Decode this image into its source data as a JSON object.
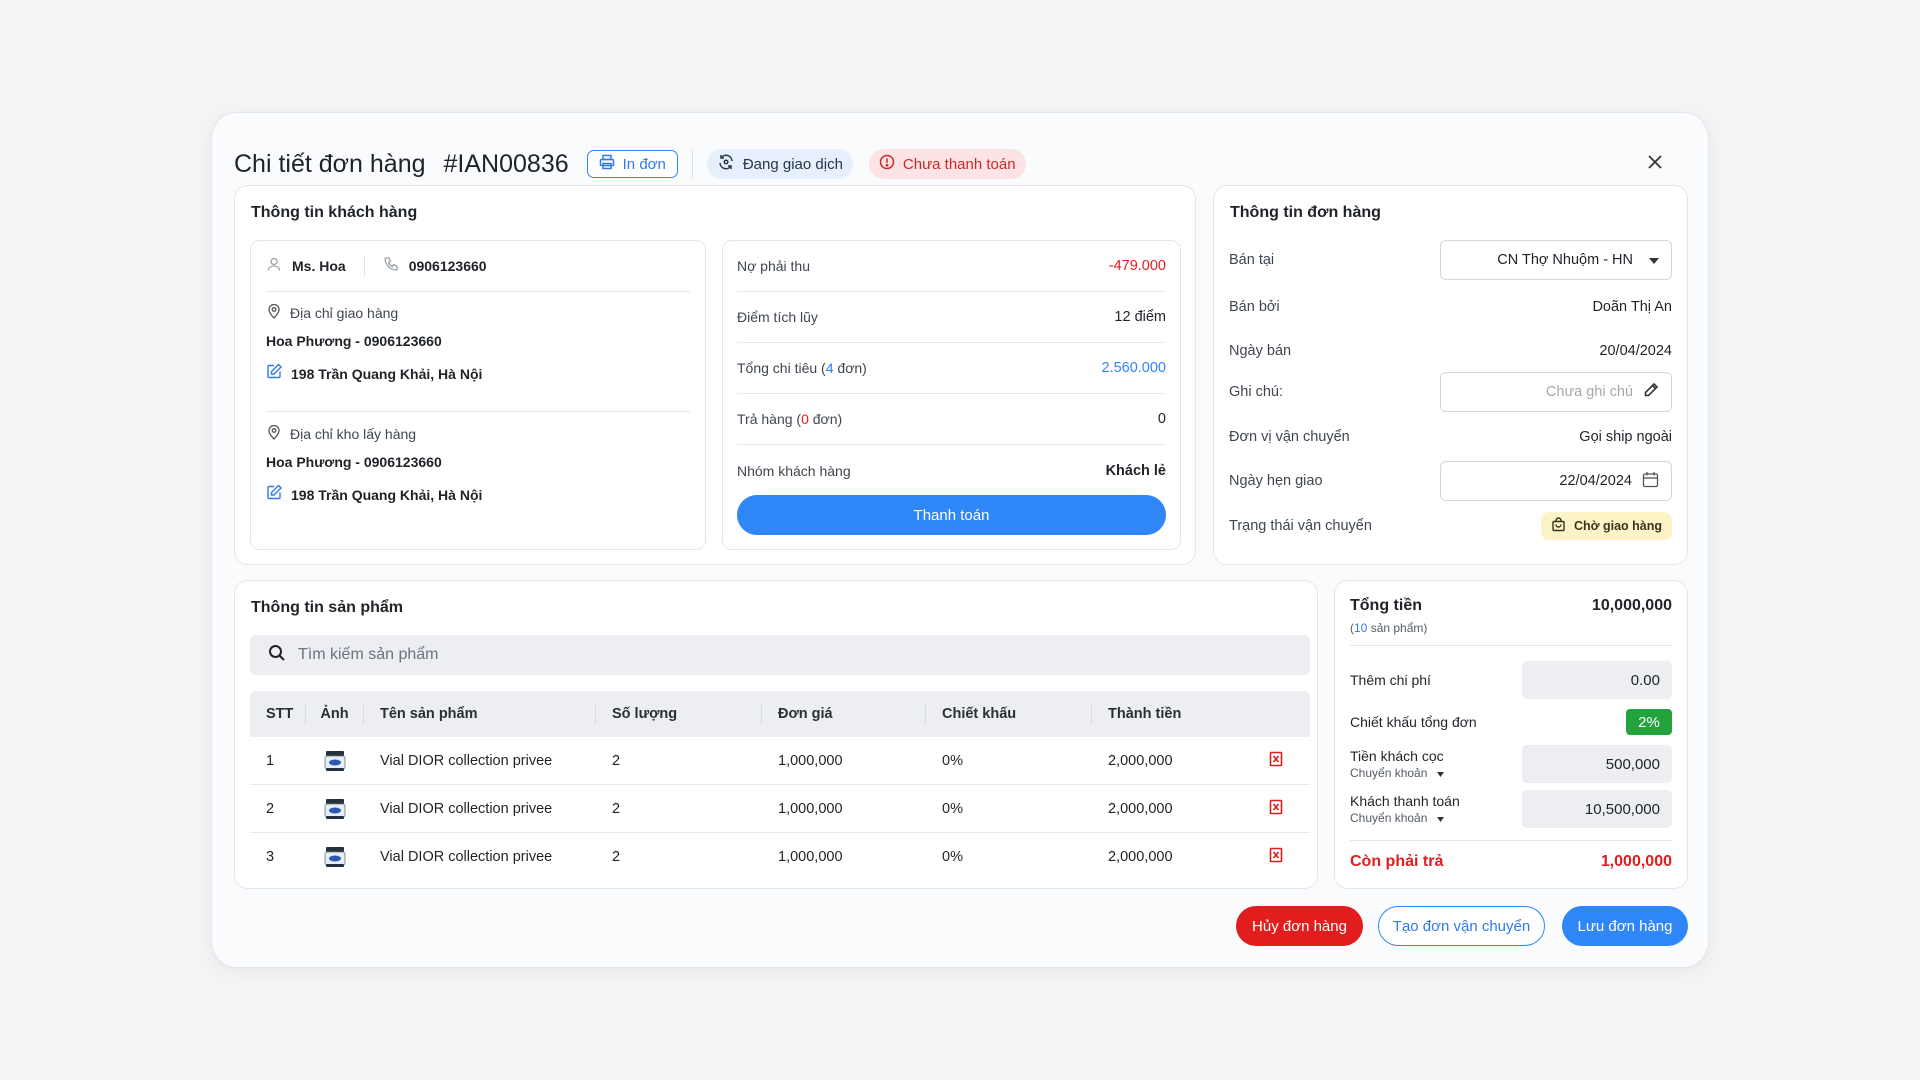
{
  "header": {
    "title": "Chi tiết đơn hàng",
    "order_id": "#IAN00836",
    "print_label": "In đơn",
    "status_trade": "Đang giao dịch",
    "status_payment": "Chưa thanh toán"
  },
  "customer": {
    "section_title": "Thông tin khách hàng",
    "name": "Ms. Hoa",
    "phone": "0906123660",
    "delivery_label": "Địa chỉ giao hàng",
    "delivery_contact": "Hoa Phương - 0906123660",
    "delivery_address": "198 Trần Quang Khải, Hà Nội",
    "pickup_label": "Địa chỉ kho lấy hàng",
    "pickup_contact": "Hoa Phương - 0906123660",
    "pickup_address": "198 Trần Quang Khải, Hà Nội"
  },
  "account": {
    "debt_label": "Nợ phải thu",
    "debt_value": "-479.000",
    "points_label": "Điểm tích lũy",
    "points_value": "12 điểm",
    "spend_label_pre": "Tổng chi tiêu (",
    "spend_count": "4",
    "spend_label_post": " đơn)",
    "spend_value": "2.560.000",
    "return_label_pre": "Trả hàng (",
    "return_count": "0",
    "return_label_post": " đơn)",
    "return_value": "0",
    "group_label": "Nhóm khách hàng",
    "group_value": "Khách lẻ",
    "pay_button": "Thanh toán"
  },
  "order": {
    "section_title": "Thông tin đơn hàng",
    "sold_at_label": "Bán tại",
    "sold_at_value": "CN Thợ Nhuộm - HN",
    "sold_by_label": "Bán bởi",
    "sold_by_value": "Doãn Thị An",
    "date_label": "Ngày bán",
    "date_value": "20/04/2024",
    "note_label": "Ghi chú:",
    "note_placeholder": "Chưa ghi chú",
    "carrier_label": "Đơn vị vận chuyển",
    "carrier_value": "Gọi ship ngoài",
    "due_label": "Ngày hẹn giao",
    "due_value": "22/04/2024",
    "ship_status_label": "Trạng thái vận chuyển",
    "ship_status_value": "Chờ giao hàng"
  },
  "products": {
    "section_title": "Thông tin sản phẩm",
    "search_placeholder": "Tìm kiếm sản phẩm",
    "columns": [
      "STT",
      "Ảnh",
      "Tên sản phẩm",
      "Số lượng",
      "Đơn giá",
      "Chiết khấu",
      "Thành tiền"
    ],
    "rows": [
      {
        "stt": "1",
        "name": "Vial DIOR collection privee",
        "qty": "2",
        "price": "1,000,000",
        "discount": "0%",
        "total": "2,000,000"
      },
      {
        "stt": "2",
        "name": "Vial DIOR collection privee",
        "qty": "2",
        "price": "1,000,000",
        "discount": "0%",
        "total": "2,000,000"
      },
      {
        "stt": "3",
        "name": "Vial DIOR collection privee",
        "qty": "2",
        "price": "1,000,000",
        "discount": "0%",
        "total": "2,000,000"
      }
    ]
  },
  "summary": {
    "total_label": "Tổng tiền",
    "total_value": "10,000,000",
    "count_pre": "(",
    "count": "10",
    "count_post": " sản phẩm)",
    "extra_label": "Thêm chi phí",
    "extra_value": "0.00",
    "discount_label": "Chiết khấu tổng đơn",
    "discount_value": "2%",
    "deposit_label": "Tiền khách cọc",
    "deposit_method": "Chuyển khoản",
    "deposit_value": "500,000",
    "paid_label": "Khách thanh toán",
    "paid_method": "Chuyển khoản",
    "paid_value": "10,500,000",
    "remaining_label": "Còn phải trả",
    "remaining_value": "1,000,000"
  },
  "actions": {
    "cancel": "Hủy đơn hàng",
    "create_shipping": "Tạo đơn vận chuyển",
    "save": "Lưu đơn hàng"
  },
  "colors": {
    "primary": "#2f86f6",
    "danger": "#e11d1d",
    "success": "#22a33b",
    "warning_bg": "#fcf3c7"
  }
}
